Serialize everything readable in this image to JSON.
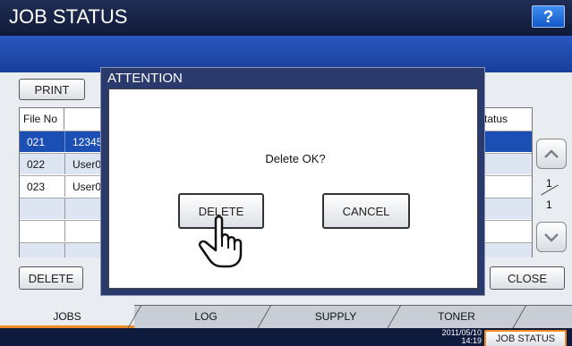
{
  "header": {
    "title": "JOB STATUS",
    "help_label": "?"
  },
  "toolbar": {
    "print_label": "PRINT"
  },
  "table": {
    "headers": {
      "file_no": "File No",
      "status": "tatus"
    },
    "rows": [
      {
        "file_no": "021",
        "name": "12345"
      },
      {
        "file_no": "022",
        "name": "User0"
      },
      {
        "file_no": "023",
        "name": "User0"
      }
    ]
  },
  "pager": {
    "current": "1",
    "total": "1"
  },
  "bottom": {
    "delete_label": "DELETE",
    "close_label": "CLOSE"
  },
  "tabs": [
    {
      "label": "JOBS"
    },
    {
      "label": "LOG"
    },
    {
      "label": "SUPPLY"
    },
    {
      "label": "TONER"
    }
  ],
  "statusbar": {
    "date": "2011/05/10",
    "time": "14:19",
    "job_status_label": "JOB STATUS"
  },
  "dialog": {
    "title": "ATTENTION",
    "message": "Delete OK?",
    "delete_label": "DELETE",
    "cancel_label": "CANCEL"
  },
  "colors": {
    "accent": "#f08a24",
    "selected_row": "#1c4fb4",
    "dialog_frame": "#2b3a6d"
  }
}
